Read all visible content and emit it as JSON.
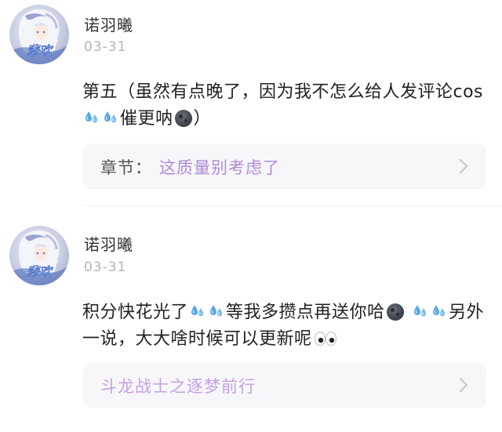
{
  "comments": [
    {
      "username": "诺羽曦",
      "date": "03-31",
      "text_parts": [
        "第五（虽然有点晚了，因为我不怎么给人发评论cos",
        "催更呐",
        "）"
      ],
      "chapter_label": "章节：",
      "chapter_title": "这质量别考虑了"
    },
    {
      "username": "诺羽曦",
      "date": "03-31",
      "text_parts": [
        "积分快花光了",
        "等我多攒点再送你哈",
        "另外一说，大大啥时候可以更新呢"
      ],
      "chapter_title": "斗龙战士之逐梦前行"
    }
  ],
  "colors": {
    "link": "#b08ad6",
    "muted": "#b5b5b5",
    "chapter_bg": "#f7f7f9"
  },
  "icons": {
    "sweat_drops": "sweat-droplets-emoji",
    "new_moon_face": "new-moon-face-emoji",
    "eyes": "eyes-emoji",
    "chevron": "chevron-right-icon"
  }
}
